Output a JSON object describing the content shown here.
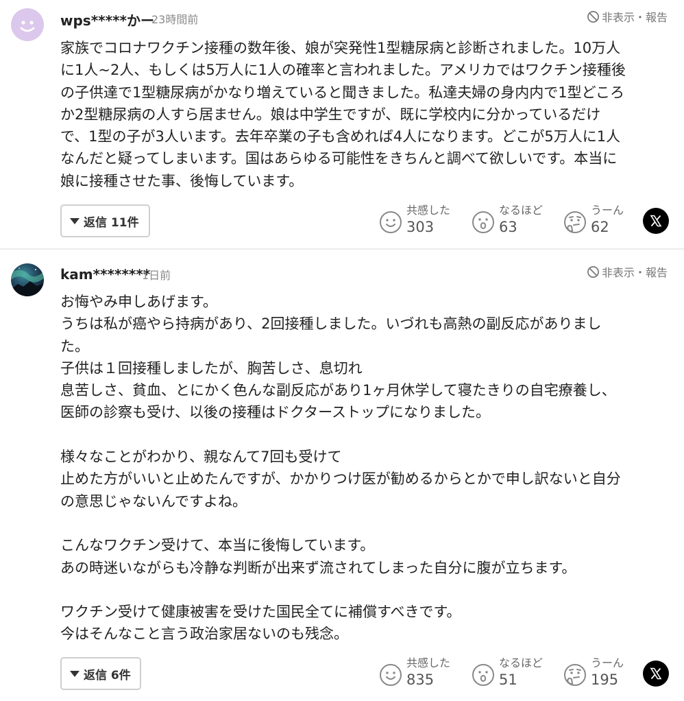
{
  "comments": [
    {
      "username": "wps*****かー",
      "time": "23時間前",
      "hide_report": "非表示・報告",
      "body": [
        "家族でコロナワクチン接種の数年後、娘が突発性1型糖尿病と診断されました。10万人",
        "に1人~2人、もしくは5万人に1人の確率と言われました。アメリカではワクチン接種後",
        "の子供達で1型糖尿病がかなり増えていると聞きました。私達夫婦の身内内で1型どころ",
        "か2型糖尿病の人すら居ません。娘は中学生ですが、既に学校内に分かっているだけ",
        "で、1型の子が3人います。去年卒業の子も含めれば4人になります。どこが5万人に1人",
        "なんだと疑ってしまいます。国はあらゆる可能性をきちんと調べて欲しいです。本当に",
        "娘に接種させた事、後悔しています。"
      ],
      "reply_label": "返信 11件",
      "reactions": {
        "empathy": {
          "label": "共感した",
          "count": "303",
          "icon": "smile-icon"
        },
        "insight": {
          "label": "なるほど",
          "count": "63",
          "icon": "surprised-icon"
        },
        "hmm": {
          "label": "うーん",
          "count": "62",
          "icon": "thinking-icon"
        }
      }
    },
    {
      "username": "kam********",
      "time": "1日前",
      "hide_report": "非表示・報告",
      "body": [
        "お悔やみ申しあげます。",
        "うちは私が癌やら持病があり、2回接種しました。いづれも高熱の副反応がありまし",
        "た。",
        "子供は１回接種しましたが、胸苦しさ、息切れ",
        "息苦しさ、貧血、とにかく色んな副反応があり1ヶ月休学して寝たきりの自宅療養し、",
        "医師の診察も受け、以後の接種はドクターストップになりました。",
        "",
        "様々なことがわかり、親なんて7回も受けて",
        "止めた方がいいと止めたんですが、かかりつけ医が勧めるからとかで申し訳ないと自分",
        "の意思じゃないんですよね。",
        "",
        "こんなワクチン受けて、本当に後悔しています。",
        "あの時迷いながらも冷静な判断が出来ず流されてしまった自分に腹が立ちます。",
        "",
        "ワクチン受けて健康被害を受けた国民全てに補償すべきです。",
        "今はそんなこと言う政治家居ないのも残念。"
      ],
      "reply_label": "返信 6件",
      "reactions": {
        "empathy": {
          "label": "共感した",
          "count": "835",
          "icon": "smile-icon"
        },
        "insight": {
          "label": "なるほど",
          "count": "51",
          "icon": "surprised-icon"
        },
        "hmm": {
          "label": "うーん",
          "count": "195",
          "icon": "thinking-icon"
        }
      }
    }
  ],
  "colors": {
    "text": "#222222",
    "muted": "#8a8a8a",
    "border": "#cfcfcf",
    "avatar1": "#dcc8ec",
    "x_button": "#000000"
  }
}
